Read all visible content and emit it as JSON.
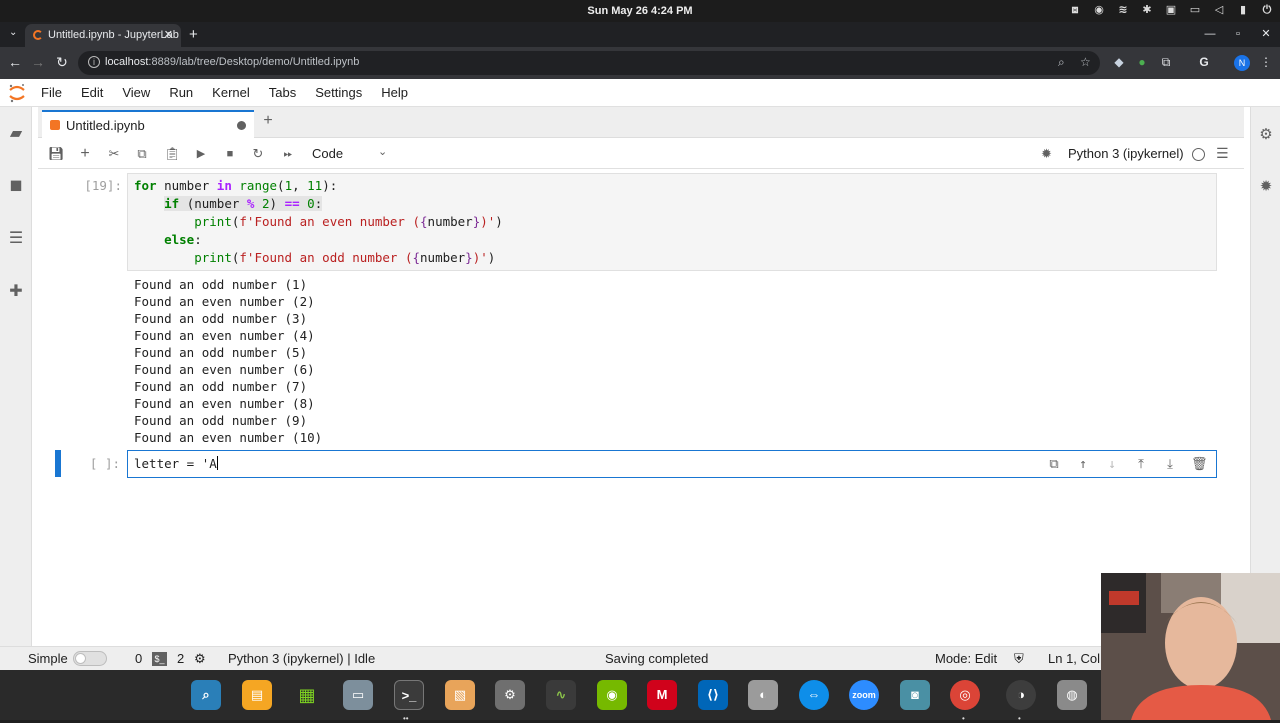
{
  "os": {
    "clock": "Sun May 26   4:24 PM",
    "tray_icons": [
      "dropbox-icon",
      "record-icon",
      "wifi-icon",
      "bluetooth-icon",
      "chat-icon",
      "window-icon",
      "volume-icon",
      "battery-icon",
      "power-icon"
    ]
  },
  "browser": {
    "tab_title": "Untitled.ipynb - JupyterLab",
    "url_host": "localhost",
    "url_rest": ":8889/lab/tree/Desktop/demo/Untitled.ipynb",
    "profile_initial": "N"
  },
  "jupyter": {
    "menu": [
      "File",
      "Edit",
      "View",
      "Run",
      "Kernel",
      "Tabs",
      "Settings",
      "Help"
    ],
    "doc_tab": "Untitled.ipynb",
    "cell_type": "Code",
    "kernel_name": "Python 3 (ipykernel)",
    "cells": [
      {
        "prompt": "[19]:",
        "code": [
          "for number in range(1, 11):",
          "    if (number % 2) == 0:",
          "        print(f'Found an even number ({number})')",
          "    else:",
          "        print(f'Found an odd number ({number})')"
        ],
        "output": [
          "Found an odd number (1)",
          "Found an even number (2)",
          "Found an odd number (3)",
          "Found an even number (4)",
          "Found an odd number (5)",
          "Found an even number (6)",
          "Found an odd number (7)",
          "Found an even number (8)",
          "Found an odd number (9)",
          "Found an even number (10)"
        ]
      },
      {
        "prompt": "[ ]:",
        "code": "letter = 'A"
      }
    ]
  },
  "status": {
    "simple_label": "Simple",
    "num_left": "0",
    "num_right": "2",
    "kernel_state": "Python 3 (ipykernel) | Idle",
    "saving": "Saving completed",
    "mode": "Mode: Edit",
    "position": "Ln 1, Col"
  },
  "dock": {
    "zoom_label": "zoom",
    "mail_label": "M"
  }
}
